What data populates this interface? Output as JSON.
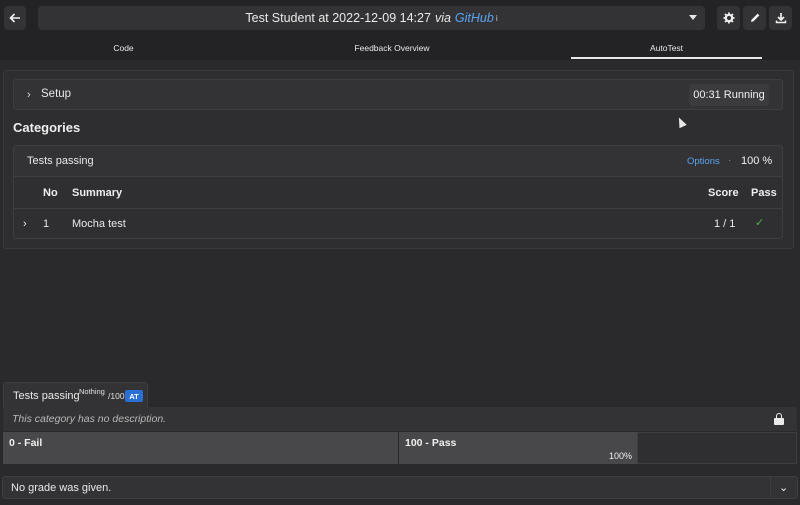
{
  "header": {
    "title": "Test Student at 2022-12-09 14:27",
    "via": "via",
    "source": "GitHub",
    "info_mark": "i"
  },
  "tabs": [
    {
      "label": "Code",
      "active": false
    },
    {
      "label": "Feedback Overview",
      "active": false
    },
    {
      "label": "AutoTest",
      "active": true
    }
  ],
  "autotest": {
    "setup_label": "Setup",
    "status": "00:31 Running",
    "categories_title": "Categories",
    "category": {
      "name": "Tests passing",
      "options_label": "Options",
      "separator": "·",
      "percent": "100 %",
      "columns": [
        "No",
        "Summary",
        "Score",
        "Pass"
      ],
      "rows": [
        {
          "no": "1",
          "summary": "Mocha test",
          "score": "1 / 1",
          "pass": "✓"
        }
      ]
    }
  },
  "rubric": {
    "tab_title": "Tests passing",
    "tab_sup": "Nothing",
    "tab_suffix": "/100",
    "badge": "AT",
    "description": "This category has no description.",
    "items": [
      {
        "label": "0 - Fail",
        "percent": ""
      },
      {
        "label": "100 - Pass",
        "percent": "100%"
      }
    ]
  },
  "grade": {
    "text": "No grade was given."
  },
  "icons": {
    "back": "arrow-left-icon",
    "settings": "gear-icon",
    "edit": "pencil-icon",
    "download": "download-icon",
    "lock": "lock-icon",
    "expand": "chevron-right-icon",
    "collapse": "chevron-down-icon"
  },
  "colors": {
    "accent": "#5aa3f0",
    "pass": "#4caf50",
    "badge": "#2a6fd6"
  }
}
